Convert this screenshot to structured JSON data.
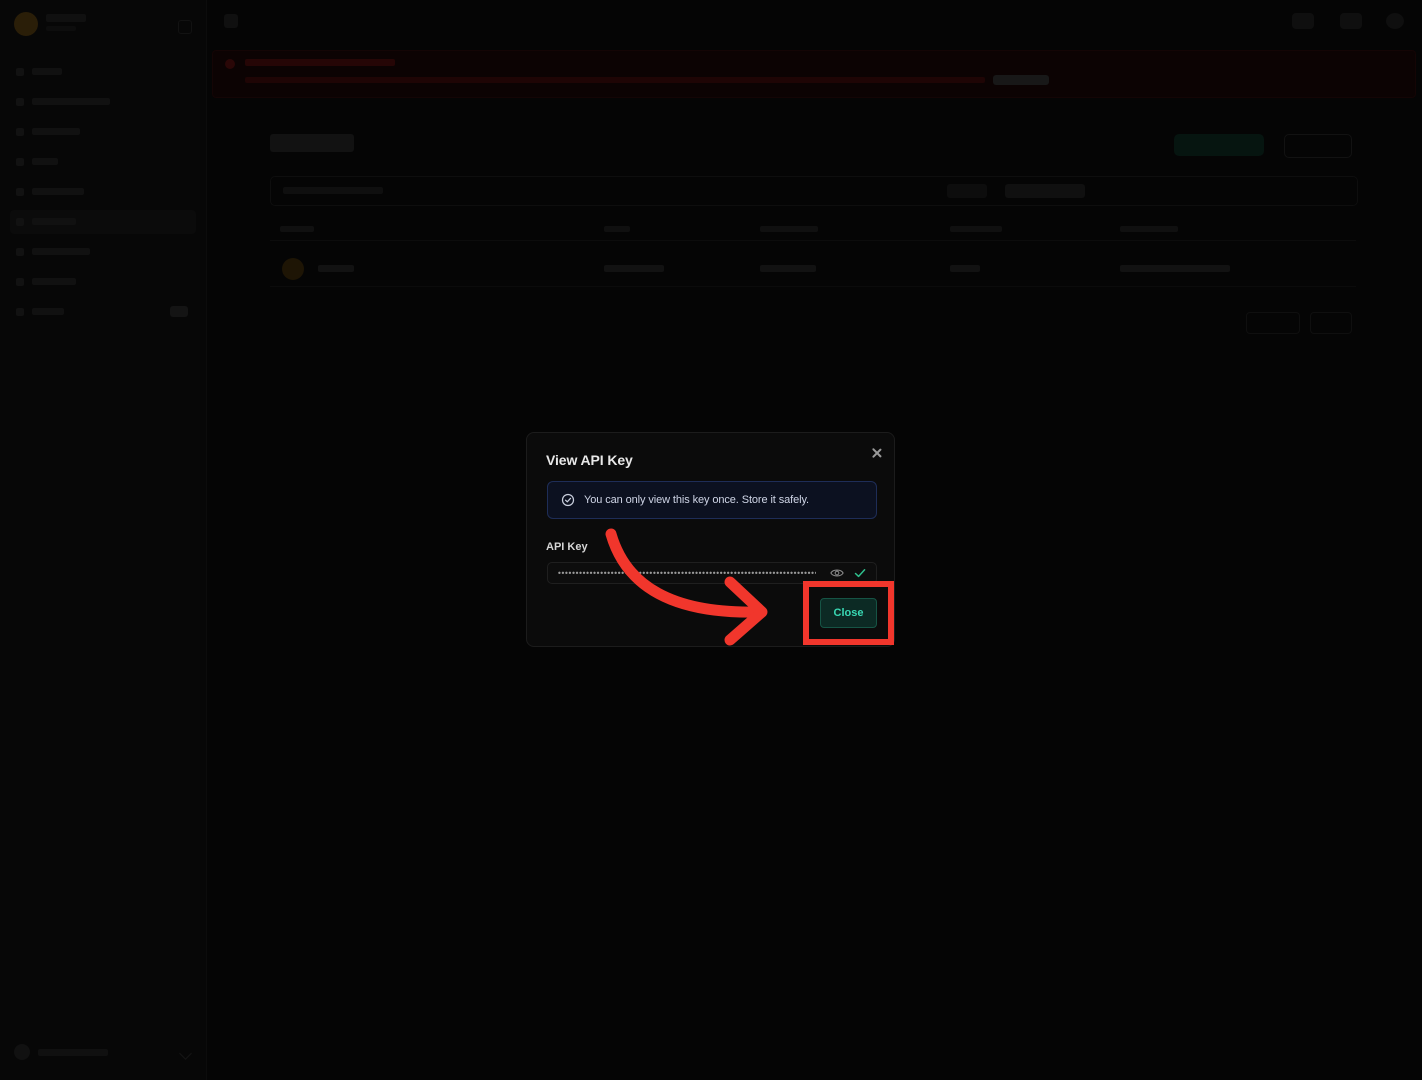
{
  "dialog": {
    "title": "View API Key",
    "notice": "You can only view this key once. Store it safely.",
    "field_label": "API Key",
    "key_value": "••••••••••••••••••••••••••••••••••••••••••••••••••••••••••••••••••••••••••••••••",
    "close_label": "Close"
  },
  "colors": {
    "backdrop": "#050505",
    "dialog_bg": "#0b0b0b",
    "notice_border": "#1e2d57",
    "accent_teal": "#39d8b3",
    "close_button_bg": "#0c2a24",
    "check_green": "#2fbf8c",
    "annotation_red": "#f1362c"
  },
  "icons": {
    "notice": "check-circle-icon",
    "dismiss": "close-icon",
    "reveal": "eye-icon",
    "confirm": "check-icon",
    "annotation": "curved-arrow-icon"
  }
}
